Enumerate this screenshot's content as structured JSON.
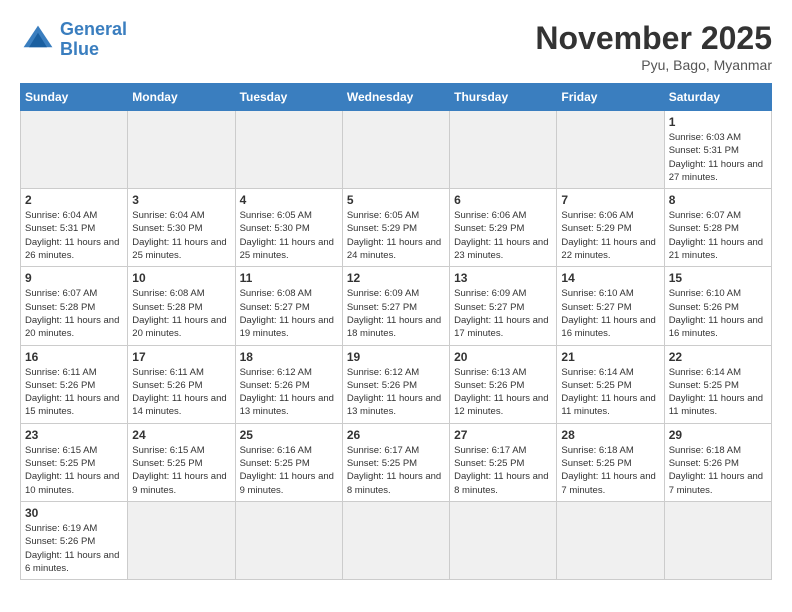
{
  "header": {
    "logo_general": "General",
    "logo_blue": "Blue",
    "month_title": "November 2025",
    "location": "Pyu, Bago, Myanmar"
  },
  "weekdays": [
    "Sunday",
    "Monday",
    "Tuesday",
    "Wednesday",
    "Thursday",
    "Friday",
    "Saturday"
  ],
  "days": {
    "1": {
      "sunrise": "6:03 AM",
      "sunset": "5:31 PM",
      "daylight": "11 hours and 27 minutes."
    },
    "2": {
      "sunrise": "6:04 AM",
      "sunset": "5:31 PM",
      "daylight": "11 hours and 26 minutes."
    },
    "3": {
      "sunrise": "6:04 AM",
      "sunset": "5:30 PM",
      "daylight": "11 hours and 25 minutes."
    },
    "4": {
      "sunrise": "6:05 AM",
      "sunset": "5:30 PM",
      "daylight": "11 hours and 25 minutes."
    },
    "5": {
      "sunrise": "6:05 AM",
      "sunset": "5:29 PM",
      "daylight": "11 hours and 24 minutes."
    },
    "6": {
      "sunrise": "6:06 AM",
      "sunset": "5:29 PM",
      "daylight": "11 hours and 23 minutes."
    },
    "7": {
      "sunrise": "6:06 AM",
      "sunset": "5:29 PM",
      "daylight": "11 hours and 22 minutes."
    },
    "8": {
      "sunrise": "6:07 AM",
      "sunset": "5:28 PM",
      "daylight": "11 hours and 21 minutes."
    },
    "9": {
      "sunrise": "6:07 AM",
      "sunset": "5:28 PM",
      "daylight": "11 hours and 20 minutes."
    },
    "10": {
      "sunrise": "6:08 AM",
      "sunset": "5:28 PM",
      "daylight": "11 hours and 20 minutes."
    },
    "11": {
      "sunrise": "6:08 AM",
      "sunset": "5:27 PM",
      "daylight": "11 hours and 19 minutes."
    },
    "12": {
      "sunrise": "6:09 AM",
      "sunset": "5:27 PM",
      "daylight": "11 hours and 18 minutes."
    },
    "13": {
      "sunrise": "6:09 AM",
      "sunset": "5:27 PM",
      "daylight": "11 hours and 17 minutes."
    },
    "14": {
      "sunrise": "6:10 AM",
      "sunset": "5:27 PM",
      "daylight": "11 hours and 16 minutes."
    },
    "15": {
      "sunrise": "6:10 AM",
      "sunset": "5:26 PM",
      "daylight": "11 hours and 16 minutes."
    },
    "16": {
      "sunrise": "6:11 AM",
      "sunset": "5:26 PM",
      "daylight": "11 hours and 15 minutes."
    },
    "17": {
      "sunrise": "6:11 AM",
      "sunset": "5:26 PM",
      "daylight": "11 hours and 14 minutes."
    },
    "18": {
      "sunrise": "6:12 AM",
      "sunset": "5:26 PM",
      "daylight": "11 hours and 13 minutes."
    },
    "19": {
      "sunrise": "6:12 AM",
      "sunset": "5:26 PM",
      "daylight": "11 hours and 13 minutes."
    },
    "20": {
      "sunrise": "6:13 AM",
      "sunset": "5:26 PM",
      "daylight": "11 hours and 12 minutes."
    },
    "21": {
      "sunrise": "6:14 AM",
      "sunset": "5:25 PM",
      "daylight": "11 hours and 11 minutes."
    },
    "22": {
      "sunrise": "6:14 AM",
      "sunset": "5:25 PM",
      "daylight": "11 hours and 11 minutes."
    },
    "23": {
      "sunrise": "6:15 AM",
      "sunset": "5:25 PM",
      "daylight": "11 hours and 10 minutes."
    },
    "24": {
      "sunrise": "6:15 AM",
      "sunset": "5:25 PM",
      "daylight": "11 hours and 9 minutes."
    },
    "25": {
      "sunrise": "6:16 AM",
      "sunset": "5:25 PM",
      "daylight": "11 hours and 9 minutes."
    },
    "26": {
      "sunrise": "6:17 AM",
      "sunset": "5:25 PM",
      "daylight": "11 hours and 8 minutes."
    },
    "27": {
      "sunrise": "6:17 AM",
      "sunset": "5:25 PM",
      "daylight": "11 hours and 8 minutes."
    },
    "28": {
      "sunrise": "6:18 AM",
      "sunset": "5:25 PM",
      "daylight": "11 hours and 7 minutes."
    },
    "29": {
      "sunrise": "6:18 AM",
      "sunset": "5:26 PM",
      "daylight": "11 hours and 7 minutes."
    },
    "30": {
      "sunrise": "6:19 AM",
      "sunset": "5:26 PM",
      "daylight": "11 hours and 6 minutes."
    }
  }
}
